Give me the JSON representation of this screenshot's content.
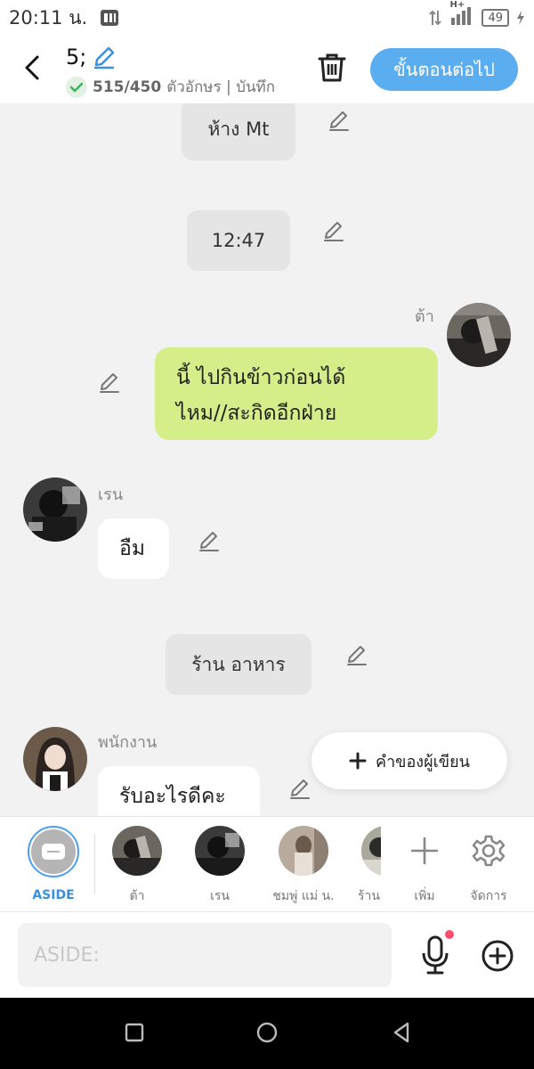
{
  "status_bar": {
    "time": "20:11 น.",
    "network": "H+",
    "battery": "49"
  },
  "header": {
    "title": "5;",
    "char_count": "515/450",
    "counter_suffix": "ตัวอักษร | บันทึก",
    "next_label": "ขั้นตอนต่อไป"
  },
  "chat": {
    "scene1": "ห้าง Mt",
    "scene2": "12:47",
    "msg1": {
      "speaker": "ต้า",
      "text_line1": "นี้ ไปกินข้าวก่อนได้",
      "text_line2": "ไหม//สะกิดอีกฝ่าย"
    },
    "msg2": {
      "speaker": "เรน",
      "text": "อืม"
    },
    "scene3": "ร้าน อาหาร",
    "msg3": {
      "speaker": "พนักงาน",
      "text": "รับอะไรดีคะ"
    },
    "author_button": "คำของผู้เขียน"
  },
  "character_bar": {
    "aside_label": "ASIDE",
    "characters": [
      {
        "name": "ต้า"
      },
      {
        "name": "เรน"
      },
      {
        "name": "ชมพู่ แม่ น."
      },
      {
        "name": "ร้าน"
      }
    ],
    "add_label": "เพิ่ม",
    "manage_label": "จัดการ"
  },
  "input": {
    "placeholder": "ASIDE:"
  },
  "colors": {
    "accent": "#5aaef0",
    "bubble_self": "#d6ee8a",
    "aside_accent": "#3a8fe0"
  }
}
